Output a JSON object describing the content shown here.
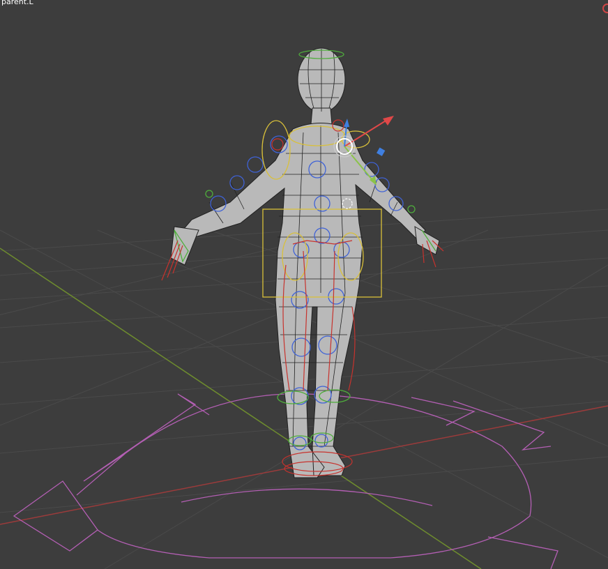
{
  "viewport": {
    "selected_bone_label": "parent.L",
    "colors": {
      "background": "#3d3d3d",
      "grid_line": "#4a4a4a",
      "x_axis": "#9c3b3b",
      "y_axis": "#6e8c2e",
      "mesh_fill": "#b9b9b9",
      "mesh_wire": "#202020",
      "root_control": "#b45fb4",
      "bone_control_blue": "#3f62d6",
      "bone_control_green": "#4fae3c",
      "bone_control_yellow": "#d9c03a",
      "bone_control_red": "#c8322d",
      "gizmo_x": "#e04848",
      "gizmo_y": "#8bc34a",
      "gizmo_z": "#3f7fe0"
    }
  }
}
